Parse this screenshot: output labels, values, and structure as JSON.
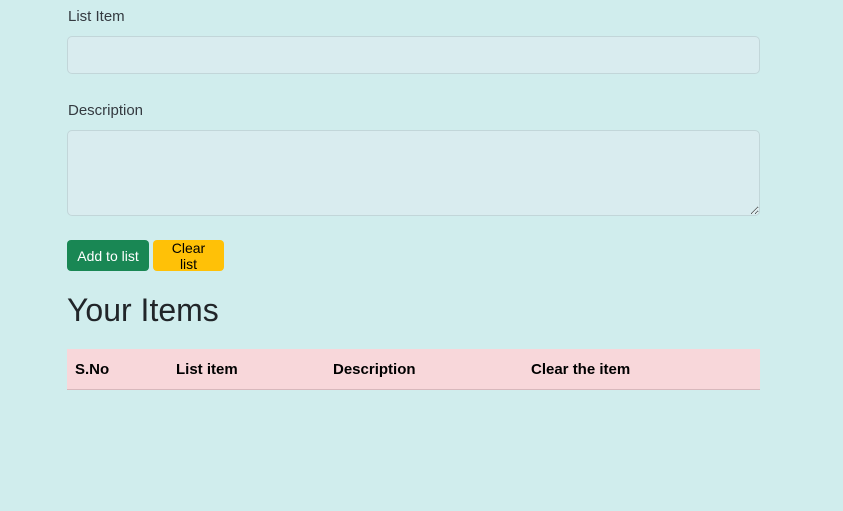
{
  "form": {
    "list_item_label": "List Item",
    "list_item_value": "",
    "description_label": "Description",
    "description_value": ""
  },
  "buttons": {
    "add_label": "Add to list",
    "clear_label": "Clear list"
  },
  "section": {
    "heading": "Your Items"
  },
  "table": {
    "headers": [
      "S.No",
      "List item",
      "Description",
      "Clear the item"
    ],
    "rows": []
  },
  "colors": {
    "page_background": "#d0eded",
    "input_background": "#d9ecef",
    "add_button": "#198754",
    "clear_button": "#ffc107",
    "table_header": "#f8d7da"
  }
}
